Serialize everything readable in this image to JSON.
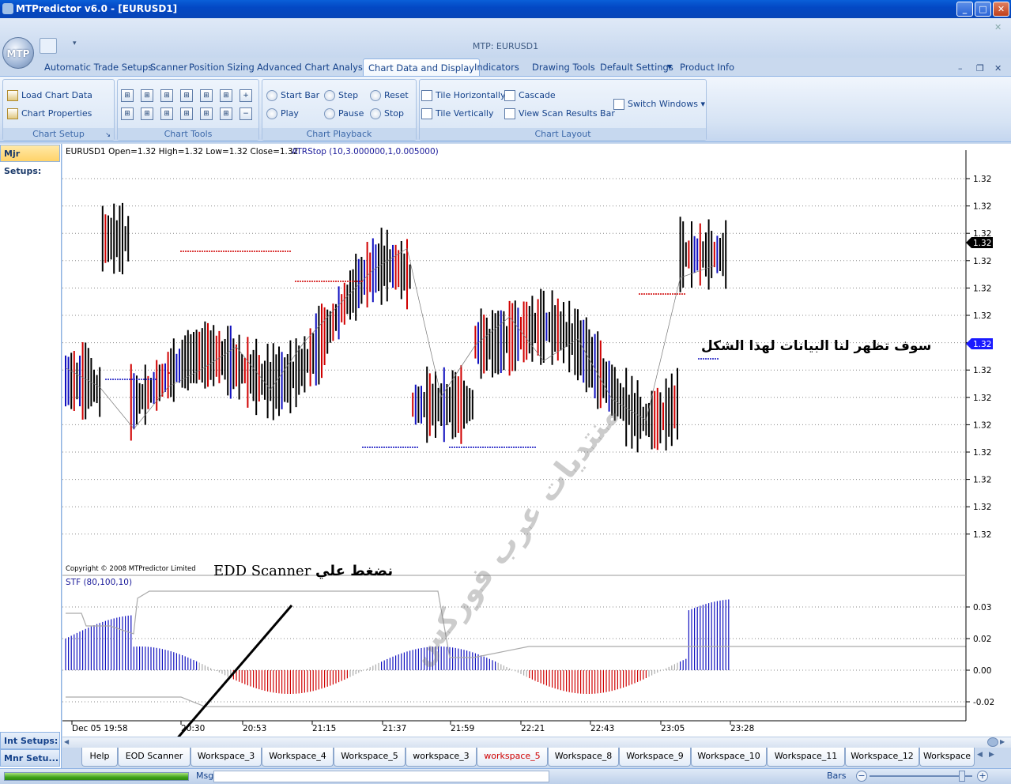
{
  "window": {
    "title": "MTPredictor v6.0 - [EURUSD1]",
    "app_title": "MTP: EURUSD1",
    "logo": "MTP"
  },
  "tabs": [
    "Automatic Trade Setups",
    "Scanner",
    "Position Sizing",
    "Advanced Chart Analysis",
    "Chart Data and Display",
    "Indicators",
    "Drawing Tools",
    "Default Settings",
    "Product Info"
  ],
  "active_tab": "Chart Data and Display",
  "ribbon": {
    "chart_setup": {
      "label": "Chart Setup",
      "load": "Load Chart Data",
      "props": "Chart Properties"
    },
    "chart_tools": {
      "label": "Chart Tools"
    },
    "chart_playback": {
      "label": "Chart Playback",
      "start_bar": "Start Bar",
      "step": "Step",
      "reset": "Reset",
      "play": "Play",
      "pause": "Pause",
      "stop": "Stop"
    },
    "chart_layout": {
      "label": "Chart Layout",
      "tile_h": "Tile Horizontally",
      "cascade": "Cascade",
      "tile_v": "Tile Vertically",
      "view_scan": "View Scan Results Bar",
      "switch": "Switch Windows"
    }
  },
  "left_panel": {
    "mjr": "Mjr Setups:",
    "int": "Int Setups:",
    "mnr": "Mnr Setu..."
  },
  "chart": {
    "header": "EURUSD1  Open=1.32  High=1.32  Low=1.32  Close=1.32",
    "indicator": "ATRStop (10,3.000000,1,0.005000)",
    "copyright": "Copyright © 2008 MTPredictor Limited",
    "stf_label": "STF (80,100,10)",
    "price_labels": [
      "1.32",
      "1.32",
      "1.32",
      "1.32",
      "1.32",
      "1.32",
      "1.32",
      "1.32",
      "1.32",
      "1.32",
      "1.32",
      "1.32",
      "1.32",
      "1.32"
    ],
    "current_price_black": "1.32",
    "current_price_blue": "1.32",
    "osc_labels": [
      "0.03",
      "0.02",
      "0.00",
      "-0.02"
    ],
    "time_labels": [
      "Dec 05 19:58",
      "20:30",
      "20:53",
      "21:15",
      "21:37",
      "21:59",
      "22:21",
      "22:43",
      "23:05",
      "23:28"
    ]
  },
  "annotations": {
    "right_note": "سوف تظهر لنا البيانات لهذا الشكل",
    "click_note": "نضغط علي",
    "click_target": "EDD Scanner",
    "watermark": "منتديات عرب فوركس"
  },
  "workspace_tabs": [
    {
      "label": "Help",
      "red": false
    },
    {
      "label": "EOD Scanner",
      "red": false
    },
    {
      "label": "Workspace_3",
      "red": false
    },
    {
      "label": "Workspace_4",
      "red": false
    },
    {
      "label": "Workspace_5",
      "red": false
    },
    {
      "label": "workspace_3",
      "red": false
    },
    {
      "label": "workspace_5",
      "red": true
    },
    {
      "label": "Workspace_8",
      "red": false
    },
    {
      "label": "Workspace_9",
      "red": false
    },
    {
      "label": "Workspace_10",
      "red": false
    },
    {
      "label": "Workspace_11",
      "red": false
    },
    {
      "label": "Workspace_12",
      "red": false
    },
    {
      "label": "Workspace",
      "red": false
    }
  ],
  "status": {
    "msg": "Msg:",
    "bars": "Bars"
  },
  "colors": {
    "up": "#d00000",
    "down": "#0000c8",
    "bar": "#000000",
    "accent": "#15428b"
  }
}
